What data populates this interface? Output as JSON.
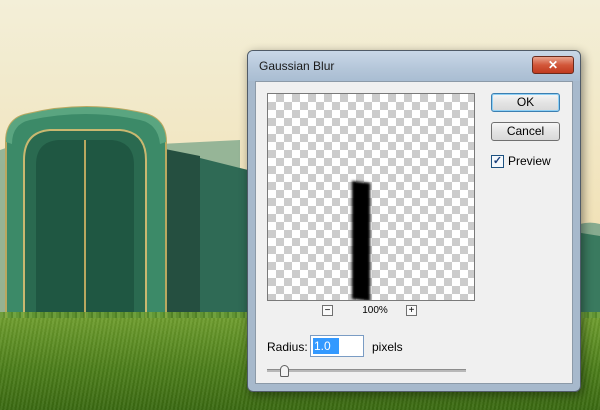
{
  "dialog": {
    "title": "Gaussian Blur",
    "close_icon": "close-icon"
  },
  "preview": {
    "zoom_label": "100%",
    "zoom_out_label": "−",
    "zoom_in_label": "+"
  },
  "buttons": {
    "ok_label": "OK",
    "cancel_label": "Cancel"
  },
  "preview_checkbox": {
    "label": "Preview",
    "checked": true,
    "check_glyph": "✓"
  },
  "radius": {
    "label": "Radius:",
    "value": "1.0",
    "unit": "pixels",
    "slider_fraction": 0.07
  },
  "colors": {
    "close_button": "#c9462a",
    "selection": "#3399ff"
  }
}
